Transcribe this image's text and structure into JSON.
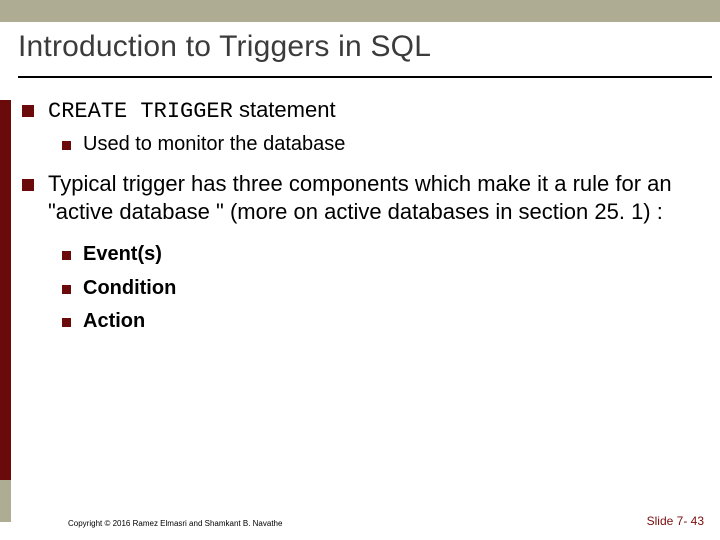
{
  "title": "Introduction to Triggers in SQL",
  "bullets": {
    "item1_code": "CREATE TRIGGER",
    "item1_rest": " statement",
    "item1_sub1": "Used to monitor the database",
    "item2": "Typical trigger has three components which make it a rule for an \"active database \" (more on active databases in section 25. 1) :",
    "item2_sub1": "Event(s)",
    "item2_sub2": "Condition",
    "item2_sub3": "Action"
  },
  "footer": {
    "copyright": "Copyright © 2016 Ramez Elmasri and Shamkant B. Navathe",
    "slide": "Slide 7- 43"
  }
}
